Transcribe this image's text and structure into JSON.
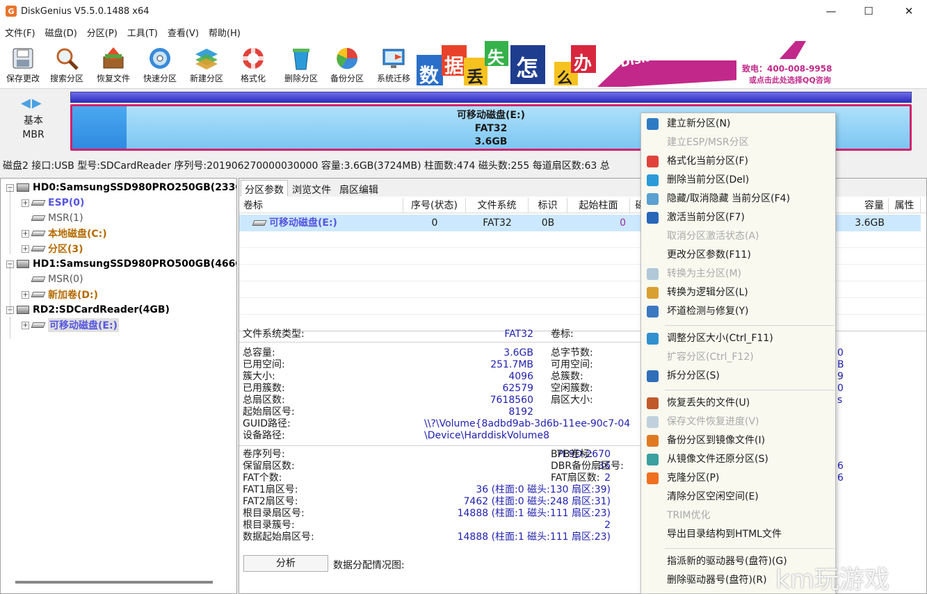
{
  "window": {
    "title": "DiskGenius V5.5.0.1488 x64",
    "logo_letter": "G"
  },
  "menubar": [
    "文件(F)",
    "磁盘(D)",
    "分区(P)",
    "工具(T)",
    "查看(V)",
    "帮助(H)"
  ],
  "toolbar": [
    {
      "label": "保存更改",
      "icon": "save-changes-icon"
    },
    {
      "label": "搜索分区",
      "icon": "magnifier-icon"
    },
    {
      "label": "恢复文件",
      "icon": "restore-box-icon"
    },
    {
      "label": "快速分区",
      "icon": "disc-icon"
    },
    {
      "label": "新建分区",
      "icon": "layers-icon"
    },
    {
      "label": "格式化",
      "icon": "lifebuoy-icon"
    },
    {
      "label": "删除分区",
      "icon": "recycle-bin-icon"
    },
    {
      "label": "备份分区",
      "icon": "pie-icon"
    },
    {
      "label": "系统迁移",
      "icon": "monitor-migrate-icon"
    }
  ],
  "ad": {
    "chars": [
      "数",
      "据",
      "丢",
      "失",
      "怎",
      "么",
      "办"
    ],
    "slogan": "DiskGenius 团队为您服务",
    "phone": "致电：400-008-9958",
    "link": "或点击此处选择QQ咨询"
  },
  "disk_map": {
    "nav": "◀▶",
    "type_line1": "基本",
    "type_line2": "MBR",
    "partition_name": "可移动磁盘(E:)",
    "partition_fs": "FAT32",
    "partition_size": "3.6GB"
  },
  "disk_info": "磁盘2 接口:USB  型号:SDCardReader  序列号:201906270000030000  容量:3.6GB(3724MB)  柱面数:474  磁头数:255  每道扇区数:63  总",
  "tree": [
    {
      "label": "HD0:SamsungSSD980PRO250GB(233G",
      "level": 0,
      "style": "black",
      "type": "disk",
      "exp": "-"
    },
    {
      "label": "ESP(0)",
      "level": 1,
      "style": "blue",
      "type": "vol",
      "exp": "+"
    },
    {
      "label": "MSR(1)",
      "level": 1,
      "style": "gray",
      "type": "vol",
      "exp": ""
    },
    {
      "label": "本地磁盘(C:)",
      "level": 1,
      "style": "brown",
      "type": "vol",
      "exp": "+"
    },
    {
      "label": "分区(3)",
      "level": 1,
      "style": "brown",
      "type": "vol",
      "exp": "+"
    },
    {
      "label": "HD1:SamsungSSD980PRO500GB(466G",
      "level": 0,
      "style": "black",
      "type": "disk",
      "exp": "-"
    },
    {
      "label": "MSR(0)",
      "level": 1,
      "style": "gray",
      "type": "vol",
      "exp": ""
    },
    {
      "label": "新加卷(D:)",
      "level": 1,
      "style": "brown",
      "type": "vol",
      "exp": "+"
    },
    {
      "label": "RD2:SDCardReader(4GB)",
      "level": 0,
      "style": "black",
      "type": "disk",
      "exp": "-"
    },
    {
      "label": "可移动磁盘(E:)",
      "level": 1,
      "style": "blue",
      "type": "vol",
      "exp": "+",
      "selected": true
    }
  ],
  "tabs": [
    "分区参数",
    "浏览文件",
    "扇区编辑"
  ],
  "table": {
    "headers": [
      "卷标",
      "序号(状态)",
      "文件系统",
      "标识",
      "起始柱面",
      "磁",
      "容量",
      "属性"
    ],
    "row": [
      "可移动磁盘(E:)",
      "0",
      "FAT32",
      "0B",
      "0",
      "",
      "3.6GB",
      ""
    ]
  },
  "details": {
    "fs_type_label": "文件系统类型:",
    "fs_type_value": "FAT32",
    "vol_label": "卷标:",
    "block1": [
      {
        "k": "总容量:",
        "v": "3.6GB",
        "k2": "总字节数:",
        "v2": "0"
      },
      {
        "k": "已用空间:",
        "v": "251.7MB",
        "k2": "可用空间:",
        "v2": "B"
      },
      {
        "k": "簇大小:",
        "v": "4096",
        "k2": "总簇数:",
        "v2": "9"
      },
      {
        "k": "已用簇数:",
        "v": "62579",
        "k2": "空闲簇数:",
        "v2": "0"
      },
      {
        "k": "总扇区数:",
        "v": "7618560",
        "k2": "扇区大小:",
        "v2": "s"
      },
      {
        "k": "起始扇区号:",
        "v": "8192",
        "k2": "",
        "v2": ""
      }
    ],
    "guid_label": "GUID路径:",
    "guid_value": "\\\\?\\Volume{8adbd9ab-3d6b-11ee-90c7-04",
    "dev_label": "设备路径:",
    "dev_value": "\\Device\\HarddiskVolume8",
    "block2": [
      {
        "k": "卷序列号:",
        "v": "7E9D-2670",
        "k2": "BPB卷标:",
        "v2": ""
      },
      {
        "k": "保留扇区数:",
        "v": "36",
        "k2": "DBR备份扇区号:",
        "v2": "6"
      },
      {
        "k": "FAT个数:",
        "v": "2",
        "k2": "FAT扇区数:",
        "v2": "6"
      },
      {
        "k": "FAT1扇区号:",
        "v": "36 (柱面:0 磁头:130 扇区:39)",
        "k2": "",
        "v2": ""
      },
      {
        "k": "FAT2扇区号:",
        "v": "7462 (柱面:0 磁头:248 扇区:31)",
        "k2": "",
        "v2": ""
      },
      {
        "k": "根目录扇区号:",
        "v": "14888 (柱面:1 磁头:111 扇区:23)",
        "k2": "",
        "v2": ""
      },
      {
        "k": "根目录簇号:",
        "v": "2",
        "k2": "",
        "v2": ""
      },
      {
        "k": "数据起始扇区号:",
        "v": "14888 (柱面:1 磁头:111 扇区:23)",
        "k2": "",
        "v2": ""
      }
    ],
    "analyze": "分析",
    "alloc": "数据分配情况图:"
  },
  "context_menu": [
    {
      "label": "建立新分区(N)",
      "enabled": true,
      "icon": "new-partition-icon",
      "color": "#2e7bc4"
    },
    {
      "label": "建立ESP/MSR分区",
      "enabled": false,
      "icon": "",
      "color": ""
    },
    {
      "label": "格式化当前分区(F)",
      "enabled": true,
      "icon": "format-icon",
      "color": "#e0433b"
    },
    {
      "label": "删除当前分区(Del)",
      "enabled": true,
      "icon": "delete-icon",
      "color": "#2a9bd8"
    },
    {
      "label": "隐藏/取消隐藏 当前分区(F4)",
      "enabled": true,
      "icon": "hide-icon",
      "color": "#5aa0d0"
    },
    {
      "label": "激活当前分区(F7)",
      "enabled": true,
      "icon": "activate-icon",
      "color": "#2866b8"
    },
    {
      "label": "取消分区激活状态(A)",
      "enabled": false,
      "icon": "",
      "color": ""
    },
    {
      "label": "更改分区参数(F11)",
      "enabled": true,
      "icon": "",
      "color": ""
    },
    {
      "label": "转换为主分区(M)",
      "enabled": false,
      "icon": "convert-primary-icon",
      "color": "#b0c8d8"
    },
    {
      "label": "转换为逻辑分区(L)",
      "enabled": true,
      "icon": "convert-logical-icon",
      "color": "#d8a030"
    },
    {
      "label": "坏道检测与修复(Y)",
      "enabled": true,
      "icon": "tools-icon",
      "color": "#3a78c0"
    },
    {
      "sep": true
    },
    {
      "label": "调整分区大小(Ctrl_F11)",
      "enabled": true,
      "icon": "resize-icon",
      "color": "#3090d0"
    },
    {
      "label": "扩容分区(Ctrl_F12)",
      "enabled": false,
      "icon": "",
      "color": ""
    },
    {
      "label": "拆分分区(S)",
      "enabled": true,
      "icon": "split-icon",
      "color": "#2f6fb8"
    },
    {
      "sep": true
    },
    {
      "label": "恢复丢失的文件(U)",
      "enabled": true,
      "icon": "recover-icon",
      "color": "#c05a2a"
    },
    {
      "label": "保存文件恢复进度(V)",
      "enabled": false,
      "icon": "save-progress-icon",
      "color": "#c0d0dc"
    },
    {
      "label": "备份分区到镜像文件(I)",
      "enabled": true,
      "icon": "backup-icon",
      "color": "#e07a20"
    },
    {
      "label": "从镜像文件还原分区(S)",
      "enabled": true,
      "icon": "restore-icon",
      "color": "#3aa0a0"
    },
    {
      "label": "克隆分区(P)",
      "enabled": true,
      "icon": "clone-icon",
      "color": "#f07020"
    },
    {
      "label": "清除分区空闲空间(E)",
      "enabled": true,
      "icon": "",
      "color": ""
    },
    {
      "label": "TRIM优化",
      "enabled": false,
      "icon": "",
      "color": ""
    },
    {
      "label": "导出目录结构到HTML文件",
      "enabled": true,
      "icon": "",
      "color": ""
    },
    {
      "sep": true
    },
    {
      "label": "指派新的驱动器号(盘符)(G)",
      "enabled": true,
      "icon": "",
      "color": ""
    },
    {
      "label": "删除驱动器号(盘符)(R)",
      "enabled": true,
      "icon": "",
      "color": ""
    }
  ],
  "watermark": "km玩游戏"
}
